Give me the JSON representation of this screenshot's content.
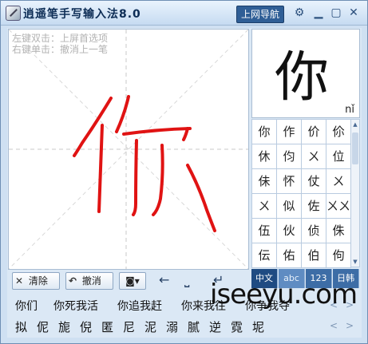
{
  "window": {
    "title": "逍遥笔手写输入法8.0",
    "web_button": "上网导航"
  },
  "titlebar_icons": [
    "gear-icon",
    "minimize-icon",
    "maximize-icon",
    "close-icon"
  ],
  "hints": {
    "line1": "左键双击：上屏首选项",
    "line2": "右键单击：撤消上一笔"
  },
  "controls": {
    "clear": "清除",
    "undo": "撤消"
  },
  "preview": {
    "char": "你",
    "pinyin": "nǐ"
  },
  "candidates": [
    "你",
    "作",
    "价",
    "伱",
    "休",
    "伨",
    "ㄨ",
    "位",
    "佅",
    "怀",
    "仗",
    "ㄨ",
    "ㄨ",
    "似",
    "佐",
    "ㄨㄨ",
    "伍",
    "伙",
    "侦",
    "侏",
    "伝",
    "佑",
    "伯",
    "佝"
  ],
  "modes": [
    "中文",
    "abc",
    "123",
    "日韩"
  ],
  "phrases": [
    "你们",
    "你死我活",
    "你追我赶",
    "你来我往",
    "你争我夺"
  ],
  "chars": [
    "拟",
    "伲",
    "旎",
    "倪",
    "匿",
    "尼",
    "泥",
    "溺",
    "腻",
    "逆",
    "霓",
    "坭"
  ],
  "watermark": "iseeyu.com",
  "colors": {
    "accent": "#2f5e96",
    "stroke": "#e01313"
  }
}
